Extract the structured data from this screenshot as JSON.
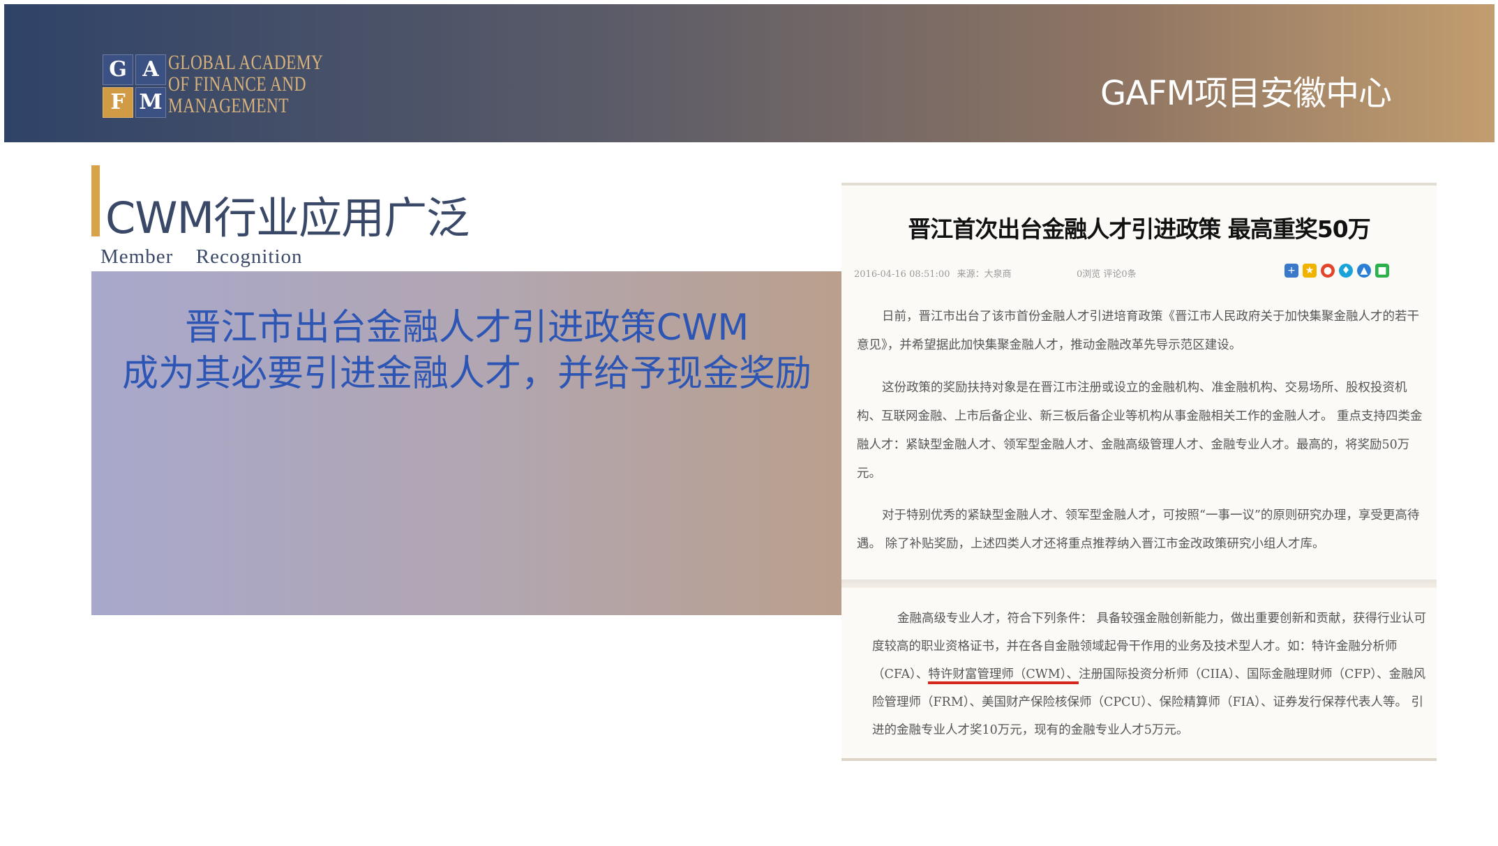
{
  "header": {
    "logo": {
      "letters": [
        "G",
        "A",
        "F",
        "M"
      ],
      "lines": [
        "GLOBAL ACADEMY",
        "OF FINANCE AND",
        "MANAGEMENT"
      ]
    },
    "center_label": "GAFM项目安徽中心"
  },
  "slide": {
    "title": "CWM行业应用广泛",
    "subtitle": "Member  Recognition",
    "panel_heading_line1": "晋江市出台金融人才引进政策CWM",
    "panel_heading_line2": "成为其必要引进金融人才，并给予现金奖励"
  },
  "article": {
    "title": "晋江首次出台金融人才引进政策 最高重奖50万",
    "meta_date": "2016-04-16 08:51:00",
    "meta_source": "来源：大泉商",
    "meta_stats": "0浏览 评论0条",
    "share_icons": [
      "plus-icon",
      "star-icon",
      "weibo-icon",
      "pin-icon",
      "qzone-icon",
      "wechat-icon"
    ],
    "paragraphs": [
      "日前，晋江市出台了该市首份金融人才引进培育政策《晋江市人民政府关于加快集聚金融人才的若干意见》，并希望据此加快集聚金融人才，推动金融改革先导示范区建设。",
      "这份政策的奖励扶持对象是在晋江市注册或设立的金融机构、准金融机构、交易场所、股权投资机构、互联网金融、上市后备企业、新三板后备企业等机构从事金融相关工作的金融人才。 重点支持四类金融人才：紧缺型金融人才、领军型金融人才、金融高级管理人才、金融专业人才。最高的，将奖励50万元。",
      "对于特别优秀的紧缺型金融人才、领军型金融人才，可按照“一事一议”的原则研究办理，享受更高待遇。 除了补贴奖励，上述四类人才还将重点推荐纳入晋江市金改政策研究小组人才库。"
    ],
    "excerpt_before": "金融高级专业人才，符合下列条件： 具备较强金融创新能力，做出重要创新和贡献，获得行业认可度较高的职业资格证书，并在各自金融领域起骨干作用的业务及技术型人才。如：特许金融分析师（CFA）、",
    "excerpt_highlight": "特许财富管理师（CWM）、",
    "excerpt_after": "注册国际投资分析师（CIIA）、国际金融理财师（CFP）、金融风险管理师（FRM）、美国财产保险核保师（CPCU）、保险精算师（FIA）、证券发行保荐代表人等。 引进的金融专业人才奖10万元，现有的金融专业人才5万元。",
    "highlight_color": "#d3281b"
  }
}
